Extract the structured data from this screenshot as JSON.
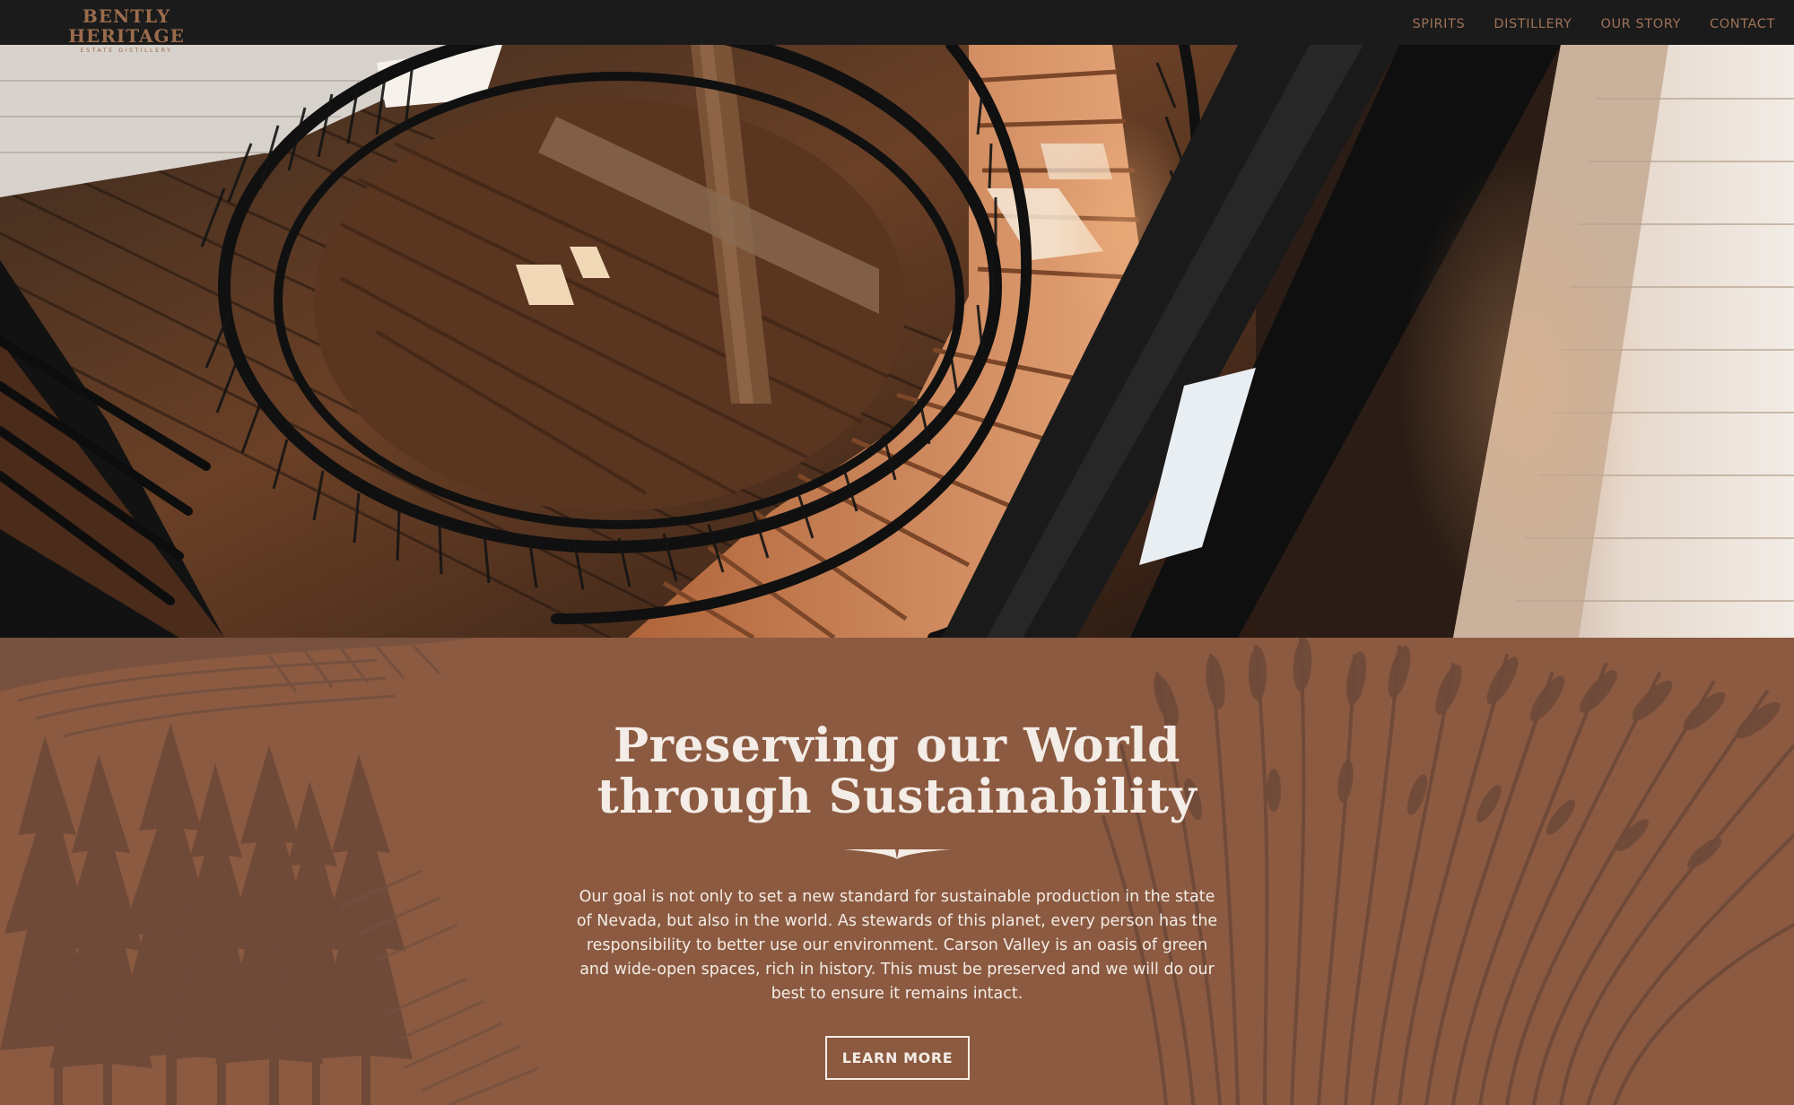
{
  "header": {
    "logo_title": "BENTLY HERITAGE",
    "logo_subtitle": "ESTATE DISTILLERY",
    "nav": [
      "SPIRITS",
      "DISTILLERY",
      "OUR STORY",
      "CONTACT"
    ]
  },
  "hero": {
    "icon": "spiral-staircase-photo"
  },
  "section": {
    "title_line1": "Preserving our World",
    "title_line2": "through Sustainability",
    "body": "Our goal is not only to set a new standard for sustainable production in the state of Nevada, but also in the world. As stewards of this planet, every person has the responsibility to better use our environment. Carson Valley is an oasis of green and wide-open spaces, rich in history. This must be preserved and we will do our best to ensure it remains intact.",
    "button_label": "LEARN MORE"
  },
  "colors": {
    "nav_bg": "#1b1b1b",
    "accent_copper": "#9a6c4d",
    "section_bg": "#8b5a40",
    "section_text": "#f4ece6"
  }
}
